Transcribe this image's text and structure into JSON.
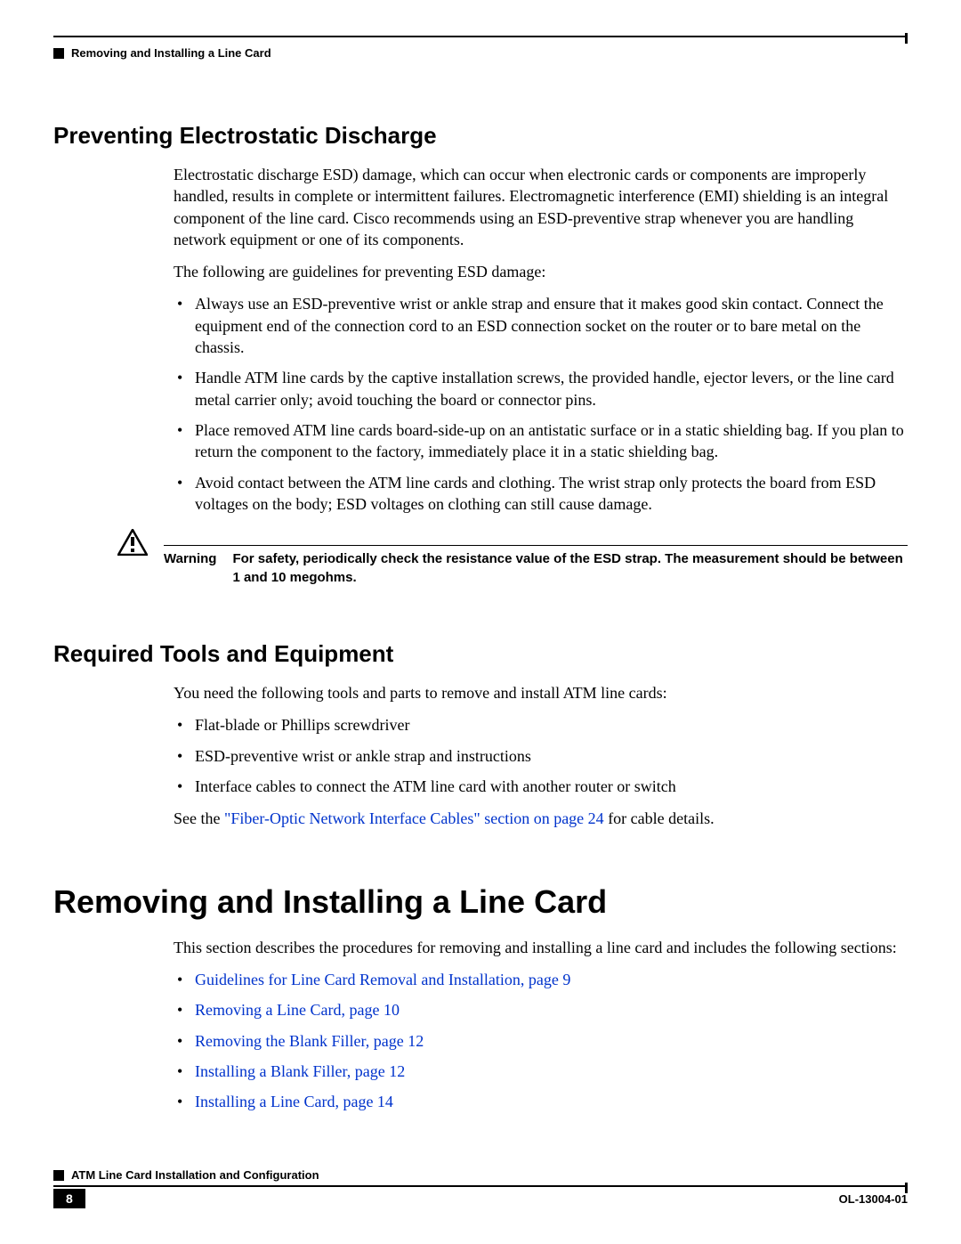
{
  "header": {
    "chapter_title": "Removing and Installing a Line Card"
  },
  "section_esd": {
    "heading": "Preventing Electrostatic Discharge",
    "p1": "Electrostatic discharge ESD) damage, which can occur when electronic cards or components are improperly handled, results in complete or intermittent failures. Electromagnetic interference (EMI) shielding is an integral component of the line card. Cisco recommends using an ESD-preventive strap whenever you are handling network equipment or one of its components.",
    "p2": "The following are guidelines for preventing ESD damage:",
    "bullets": [
      "Always use an ESD-preventive wrist or ankle strap and ensure that it makes good skin contact. Connect the equipment end of the connection cord to an ESD connection socket on the router or to bare metal on the chassis.",
      "Handle ATM line cards by the captive installation screws, the provided handle, ejector levers, or the line card metal carrier only; avoid touching the board or connector pins.",
      "Place removed ATM line cards board-side-up on an antistatic surface or in a static shielding bag. If you plan to return the component to the factory, immediately place it in a static shielding bag.",
      "Avoid contact between the ATM line cards and clothing. The wrist strap only protects the board from ESD voltages on the body; ESD voltages on clothing can still cause damage."
    ]
  },
  "warning": {
    "label": "Warning",
    "text": "For safety, periodically check the resistance value of the ESD strap. The measurement should be between 1 and 10 megohms."
  },
  "section_tools": {
    "heading": "Required Tools and Equipment",
    "p1": "You need the following tools and parts to remove and install ATM line cards:",
    "bullets": [
      "Flat-blade or Phillips screwdriver",
      "ESD-preventive wrist or ankle strap and instructions",
      "Interface cables to connect the ATM line card with another router or switch"
    ],
    "see_prefix": "See the ",
    "see_link": "\"Fiber-Optic Network Interface Cables\" section on page 24",
    "see_suffix": " for cable details."
  },
  "section_main": {
    "heading": "Removing and Installing a Line Card",
    "p1": "This section describes the procedures for removing and installing a line card and includes the following sections:",
    "links": [
      "Guidelines for Line Card Removal and Installation, page 9",
      "Removing a Line Card, page 10",
      "Removing the Blank Filler, page 12",
      "Installing a Blank Filler, page 12",
      "Installing a Line Card, page 14"
    ]
  },
  "footer": {
    "doc_title": "ATM Line Card Installation and Configuration",
    "page_num": "8",
    "doc_id": "OL-13004-01"
  }
}
